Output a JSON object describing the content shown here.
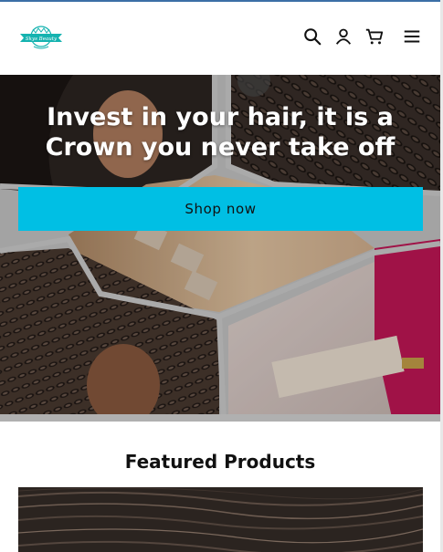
{
  "header": {
    "logo_icon": "brand-badge-logo",
    "logo_text": "Skys Beauty",
    "icons": [
      "search-icon",
      "account-icon",
      "cart-icon",
      "menu-icon"
    ]
  },
  "hero": {
    "title": "Invest in your hair, it is a Crown you never take off",
    "button_label": "Shop now"
  },
  "featured": {
    "title": "Featured Products"
  },
  "colors": {
    "accent": "#00bfe4",
    "logo": "#15b3b0"
  }
}
